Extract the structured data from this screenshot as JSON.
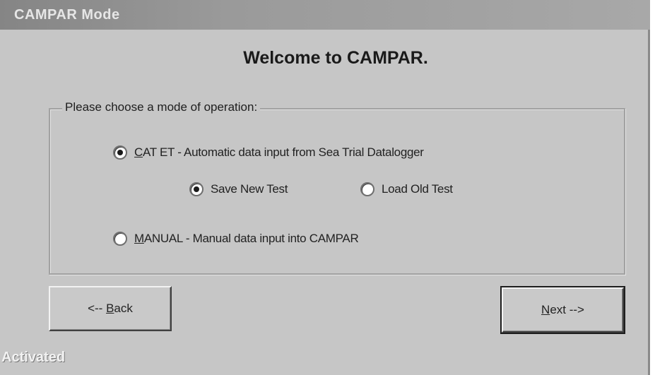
{
  "window": {
    "title": "CAMPAR Mode"
  },
  "welcome": "Welcome to CAMPAR.",
  "mode_group": {
    "legend": "Please choose a mode of operation:",
    "cat_et": {
      "prefix_underlined": "C",
      "label_rest": "AT ET - Automatic data input from Sea Trial Datalogger",
      "selected": true
    },
    "save_new_test": {
      "label": "Save New Test",
      "selected": true
    },
    "load_old_test": {
      "label": "Load Old Test",
      "selected": false
    },
    "manual": {
      "prefix_underlined": "M",
      "label_rest": "ANUAL - Manual data input into CAMPAR",
      "selected": false
    }
  },
  "buttons": {
    "back_prefix": "<-- ",
    "back_underlined": "B",
    "back_rest": "ack",
    "next_underlined": "N",
    "next_rest": "ext -->"
  },
  "status": {
    "text": "Activated"
  }
}
